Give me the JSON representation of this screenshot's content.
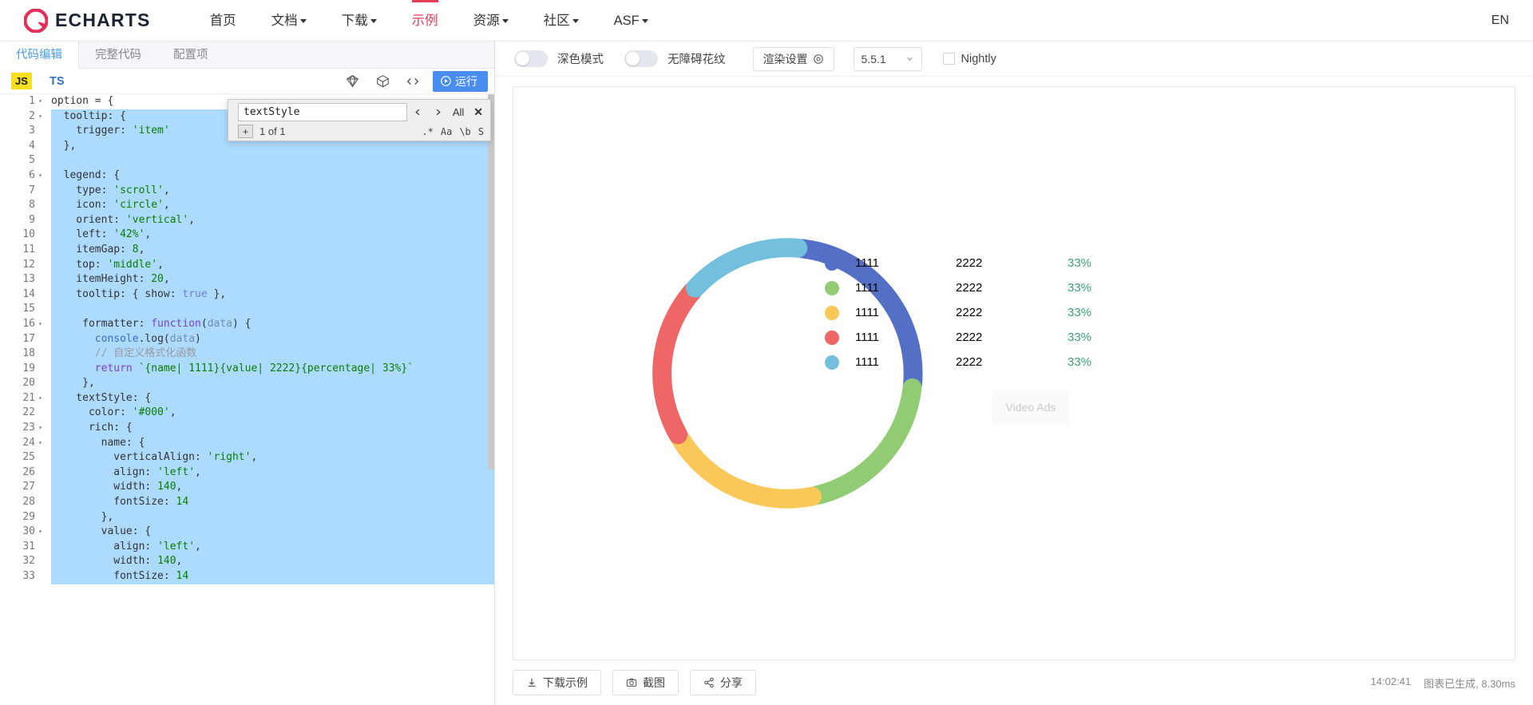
{
  "nav": {
    "brand": "ECHARTS",
    "items": [
      {
        "label": "首页",
        "has_caret": false,
        "active": false
      },
      {
        "label": "文档",
        "has_caret": true,
        "active": false
      },
      {
        "label": "下载",
        "has_caret": true,
        "active": false
      },
      {
        "label": "示例",
        "has_caret": false,
        "active": true
      },
      {
        "label": "资源",
        "has_caret": true,
        "active": false
      },
      {
        "label": "社区",
        "has_caret": true,
        "active": false
      },
      {
        "label": "ASF",
        "has_caret": true,
        "active": false
      }
    ],
    "lang": "EN",
    "accent_color": "#e43c59"
  },
  "editor": {
    "tabs": [
      {
        "label": "代码编辑",
        "active": true
      },
      {
        "label": "完整代码",
        "active": false
      },
      {
        "label": "配置项",
        "active": false
      }
    ],
    "lang_js": "JS",
    "lang_ts": "TS",
    "run_label": "运行",
    "icons": [
      "gem-icon",
      "cube-icon",
      "code-icon",
      "play-icon"
    ],
    "find": {
      "query": "textStyle",
      "prev_icon": "chevron-left-icon",
      "next_icon": "chevron-right-icon",
      "all_label": "All",
      "close_icon": "close-icon",
      "expand_label": "+",
      "match_count": "1 of 1",
      "options": [
        ".*",
        "Aa",
        "\\b",
        "S"
      ]
    },
    "code_lines": [
      {
        "n": 1,
        "fold": "▾",
        "info": "",
        "text": "option = {"
      },
      {
        "n": 2,
        "fold": "▾",
        "info": "",
        "text": "  tooltip: {"
      },
      {
        "n": 3,
        "fold": "",
        "info": "",
        "text": "    trigger: 'item'"
      },
      {
        "n": 4,
        "fold": "",
        "info": "",
        "text": "  },"
      },
      {
        "n": 5,
        "fold": "",
        "info": "",
        "text": ""
      },
      {
        "n": 6,
        "fold": "▾",
        "info": "",
        "text": "  legend: {"
      },
      {
        "n": 7,
        "fold": "",
        "info": "",
        "text": "    type: 'scroll',"
      },
      {
        "n": 8,
        "fold": "",
        "info": "",
        "text": "    icon: 'circle',"
      },
      {
        "n": 9,
        "fold": "",
        "info": "",
        "text": "    orient: 'vertical',"
      },
      {
        "n": 10,
        "fold": "",
        "info": "",
        "text": "    left: '42%',"
      },
      {
        "n": 11,
        "fold": "",
        "info": "",
        "text": "    itemGap: 8,"
      },
      {
        "n": 12,
        "fold": "",
        "info": "",
        "text": "    top: 'middle',"
      },
      {
        "n": 13,
        "fold": "",
        "info": "",
        "text": "    itemHeight: 20,"
      },
      {
        "n": 14,
        "fold": "",
        "info": "",
        "text": "    tooltip: { show: true },"
      },
      {
        "n": 15,
        "fold": "",
        "info": "",
        "text": ""
      },
      {
        "n": 16,
        "fold": "▾",
        "info": "",
        "text": "     formatter: function(data) {"
      },
      {
        "n": 17,
        "fold": "",
        "info": "i",
        "text": "       console.log(data)"
      },
      {
        "n": 18,
        "fold": "",
        "info": "",
        "text": "       // 自定义格式化函数"
      },
      {
        "n": 19,
        "fold": "",
        "info": "i",
        "text": "       return `{name| 1111}{value| 2222}{percentage| 33%}`"
      },
      {
        "n": 20,
        "fold": "",
        "info": "",
        "text": "     },"
      },
      {
        "n": 21,
        "fold": "▾",
        "info": "",
        "text": "    textStyle: {"
      },
      {
        "n": 22,
        "fold": "",
        "info": "",
        "text": "      color: '#000',"
      },
      {
        "n": 23,
        "fold": "▾",
        "info": "",
        "text": "      rich: {"
      },
      {
        "n": 24,
        "fold": "▾",
        "info": "",
        "text": "        name: {"
      },
      {
        "n": 25,
        "fold": "",
        "info": "",
        "text": "          verticalAlign: 'right',"
      },
      {
        "n": 26,
        "fold": "",
        "info": "",
        "text": "          align: 'left',"
      },
      {
        "n": 27,
        "fold": "",
        "info": "",
        "text": "          width: 140,"
      },
      {
        "n": 28,
        "fold": "",
        "info": "",
        "text": "          fontSize: 14"
      },
      {
        "n": 29,
        "fold": "",
        "info": "",
        "text": "        },"
      },
      {
        "n": 30,
        "fold": "▾",
        "info": "",
        "text": "        value: {"
      },
      {
        "n": 31,
        "fold": "",
        "info": "",
        "text": "          align: 'left',"
      },
      {
        "n": 32,
        "fold": "",
        "info": "",
        "text": "          width: 140,"
      },
      {
        "n": 33,
        "fold": "",
        "info": "",
        "text": "          fontSize: 14"
      }
    ]
  },
  "preview": {
    "dark_mode_label": "深色模式",
    "dark_mode_on": false,
    "accessibility_label": "无障碍花纹",
    "accessibility_on": false,
    "render_settings_label": "渲染设置",
    "render_settings_icon": "gear-icon",
    "version": "5.5.1",
    "version_caret": "chevron-down-icon",
    "nightly_label": "Nightly",
    "nightly_checked": false,
    "watermark": "Video Ads",
    "footer": {
      "download_label": "下载示例",
      "download_icon": "download-icon",
      "screenshot_label": "截图",
      "screenshot_icon": "camera-icon",
      "share_label": "分享",
      "share_icon": "share-icon",
      "time": "14:02:41",
      "status": "图表已生成, 8.30ms"
    }
  },
  "chart_data": {
    "type": "pie",
    "title": "",
    "subtype": "doughnut",
    "legend_position": "right",
    "legend_columns": [
      "name",
      "value",
      "percentage"
    ],
    "slices": [
      {
        "name": "1111",
        "value": "2222",
        "percentage": "33%",
        "color": "#5470c6",
        "fraction": 0.25
      },
      {
        "name": "1111",
        "value": "2222",
        "percentage": "33%",
        "color": "#91cc75",
        "fraction": 0.2
      },
      {
        "name": "1111",
        "value": "2222",
        "percentage": "33%",
        "color": "#fac858",
        "fraction": 0.2
      },
      {
        "name": "1111",
        "value": "2222",
        "percentage": "33%",
        "color": "#ee6666",
        "fraction": 0.2
      },
      {
        "name": "1111",
        "value": "2222",
        "percentage": "33%",
        "color": "#73c0de",
        "fraction": 0.15
      }
    ]
  }
}
